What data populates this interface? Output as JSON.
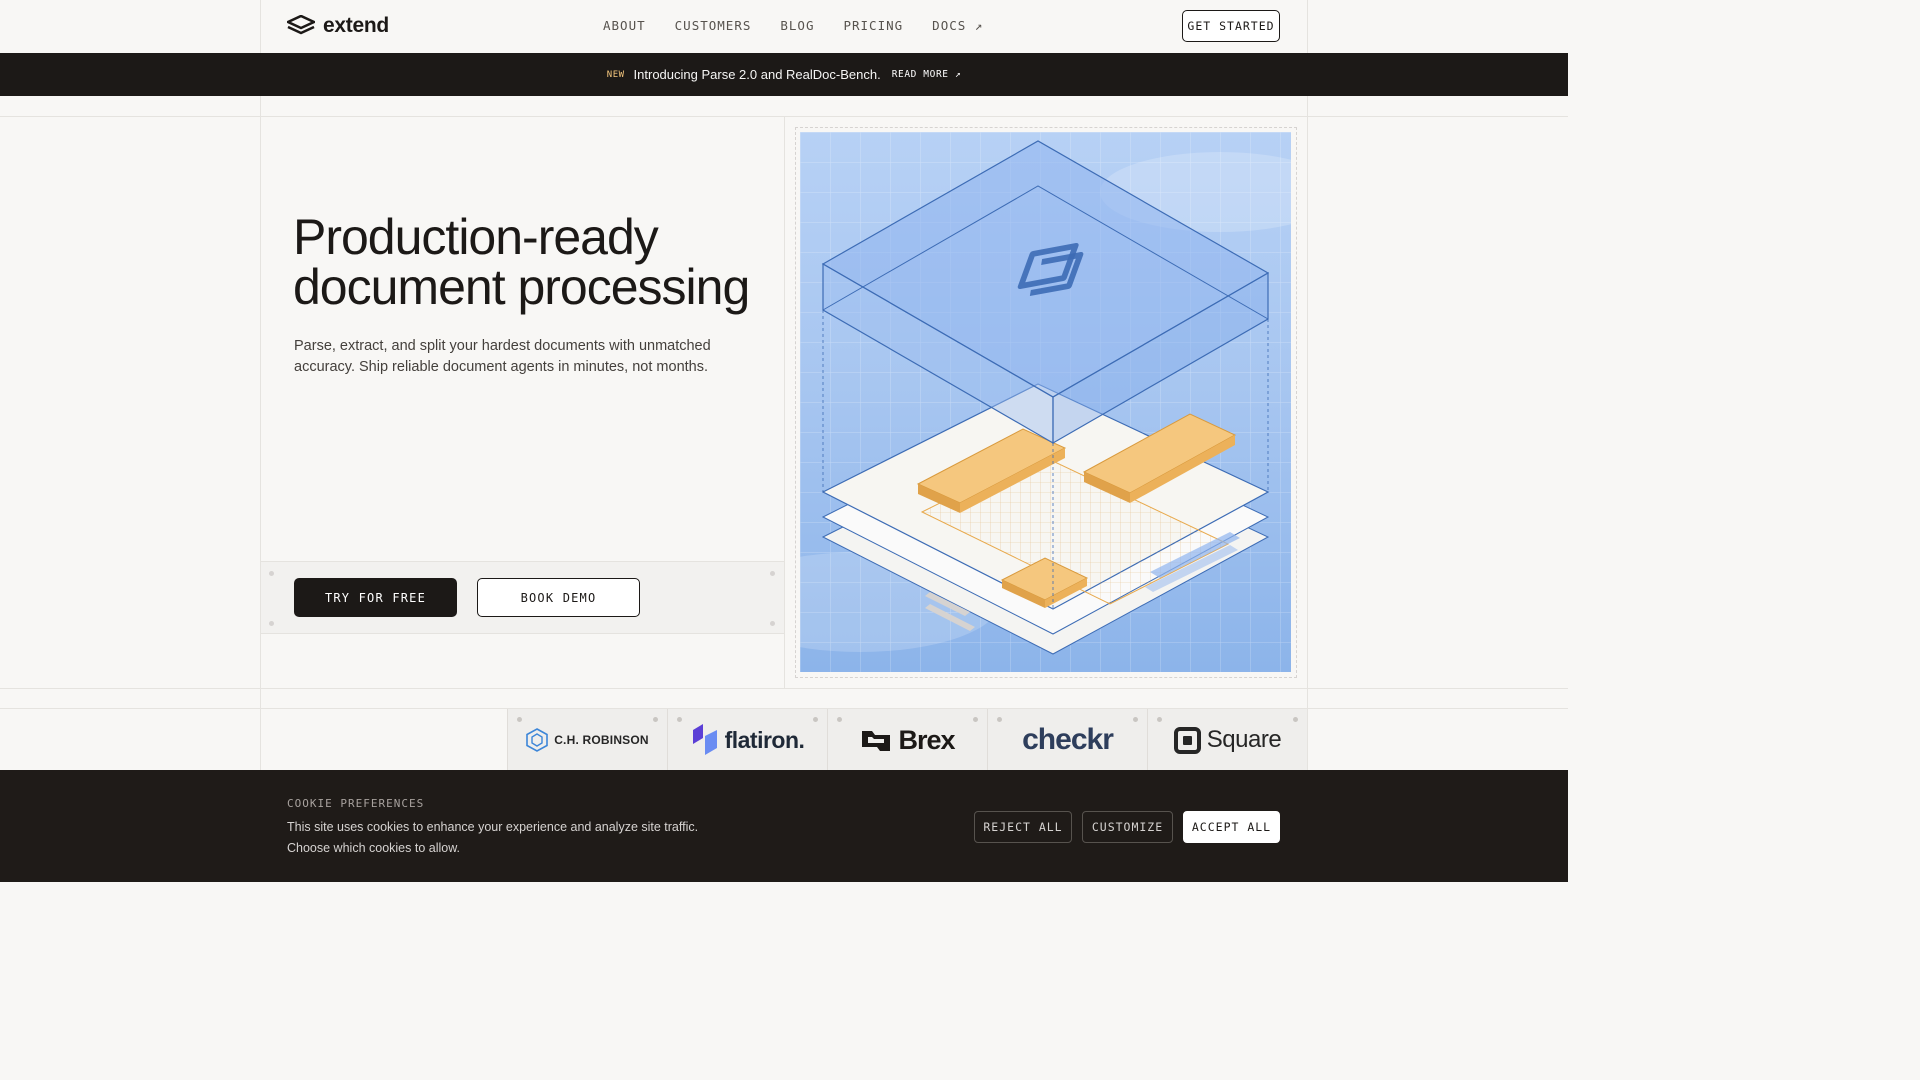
{
  "brand": {
    "name": "extend"
  },
  "nav": {
    "links": [
      "ABOUT",
      "CUSTOMERS",
      "BLOG",
      "PRICING",
      "DOCS ↗"
    ],
    "cta": "GET STARTED"
  },
  "announcement": {
    "tag": "NEW",
    "text": "Introducing Parse 2.0 and RealDoc-Bench.",
    "link": "READ MORE ↗"
  },
  "hero": {
    "title_line1": "Production-ready",
    "title_line2": "document processing",
    "subtitle": "Parse, extract, and split your hardest documents with unmatched accuracy. Ship reliable document agents in minutes, not months.",
    "primary_cta": "TRY FOR FREE",
    "secondary_cta": "BOOK DEMO"
  },
  "customers": [
    "C.H. ROBINSON",
    "flatiron.",
    "Brex",
    "checkr",
    "Square"
  ],
  "cookie": {
    "title": "COOKIE PREFERENCES",
    "text": "This site uses cookies to enhance your experience and analyze site traffic. Choose which cookies to allow.",
    "reject": "REJECT ALL",
    "customize": "CUSTOMIZE",
    "accept": "ACCEPT ALL"
  },
  "colors": {
    "dark": "#1c1917",
    "accent_orange": "#f0b862",
    "illo_blue": "#a9c8f2",
    "line_blue": "#3d6cb5"
  }
}
